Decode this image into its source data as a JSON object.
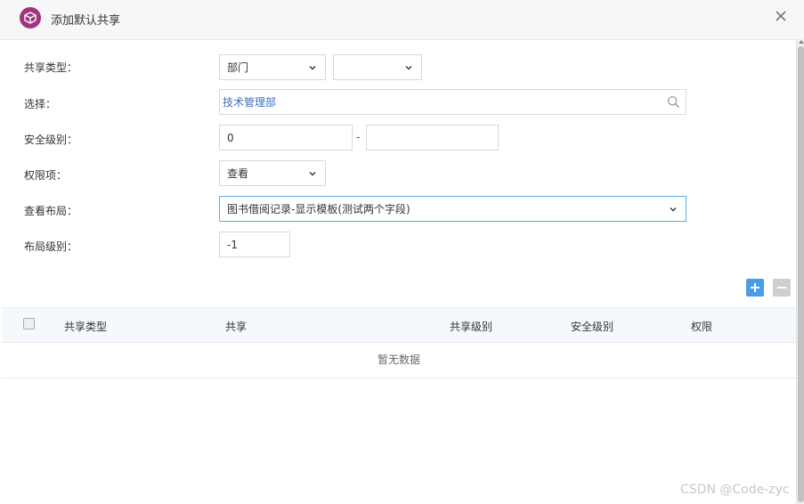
{
  "dialog": {
    "title": "添加默认共享"
  },
  "form": {
    "share_type": {
      "label": "共享类型：",
      "value": "部门",
      "sub_value": ""
    },
    "select": {
      "label": "选择：",
      "value": "技术管理部"
    },
    "security_level": {
      "label": "安全级别：",
      "min": "0",
      "separator": "-",
      "max": ""
    },
    "permission": {
      "label": "权限项：",
      "value": "查看"
    },
    "view_layout": {
      "label": "查看布局：",
      "value": "图书借阅记录-显示模板(测试两个字段)"
    },
    "layout_level": {
      "label": "布局级别：",
      "value": "-1"
    }
  },
  "table": {
    "columns": [
      "共享类型",
      "共享",
      "共享级别",
      "安全级别",
      "权限"
    ],
    "empty_text": "暂无数据"
  },
  "watermark": "CSDN @Code-zyc",
  "colors": {
    "logo": "#a0357e",
    "add_button": "#4a9ce8",
    "focus_border": "#5aaee8",
    "link_text": "#3b6fc3"
  }
}
